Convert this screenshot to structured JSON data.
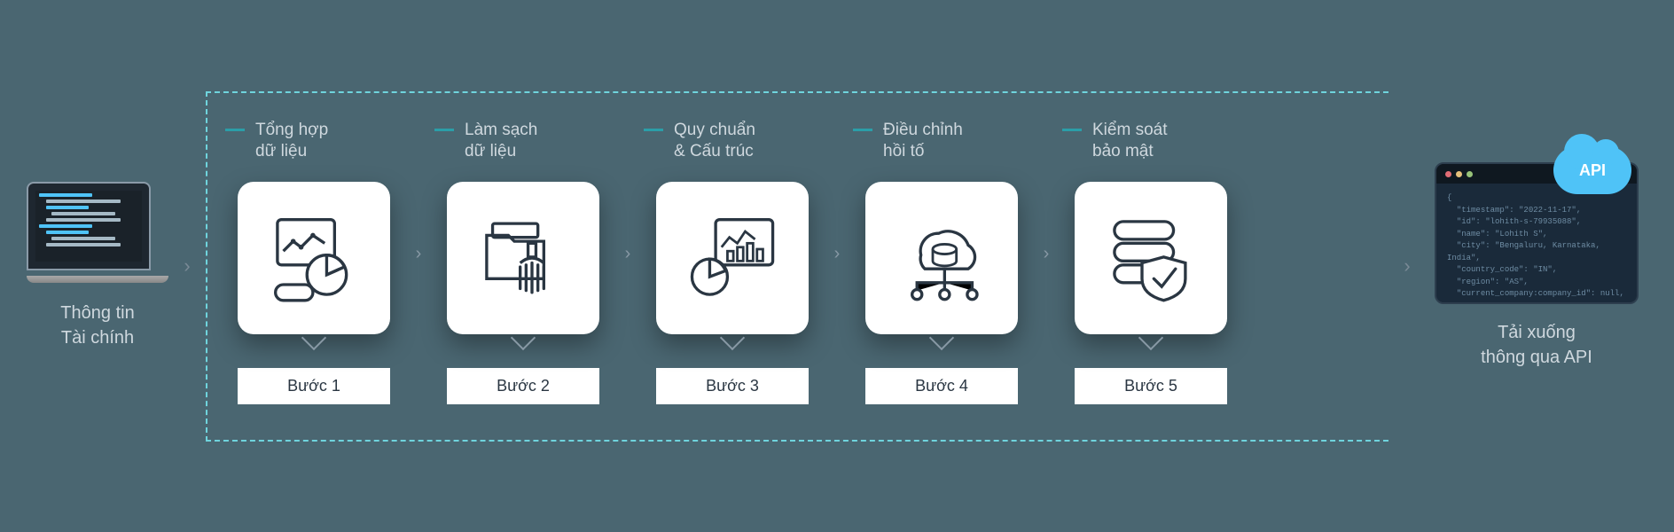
{
  "input": {
    "label_line1": "Thông tin",
    "label_line2": "Tài chính"
  },
  "steps": [
    {
      "title_line1": "Tổng hợp",
      "title_line2": "dữ liệu",
      "badge": "Bước 1",
      "icon": "chart-pie-icon"
    },
    {
      "title_line1": "Làm sạch",
      "title_line2": "dữ liệu",
      "badge": "Bước 2",
      "icon": "clean-folder-icon"
    },
    {
      "title_line1": "Quy chuẩn",
      "title_line2": "& Cấu trúc",
      "badge": "Bước 3",
      "icon": "bar-graph-icon"
    },
    {
      "title_line1": "Điều chỉnh",
      "title_line2": "hồi tố",
      "badge": "Bước 4",
      "icon": "cloud-network-icon"
    },
    {
      "title_line1": "Kiểm soát",
      "title_line2": "bảo mật",
      "badge": "Bước 5",
      "icon": "shield-stack-icon"
    }
  ],
  "output": {
    "cloud_label": "API",
    "label_line1": "Tải xuống",
    "label_line2": "thông qua API",
    "json_sample": {
      "l1": "\"timestamp\": \"2022-11-17\",",
      "l2": "\"id\": \"lohith-s-79935088\",",
      "l3": "\"name\": \"Lohith S\",",
      "l4": "\"city\": \"Bengaluru, Karnataka, India\",",
      "l5": "\"country_code\": \"IN\",",
      "l6": "\"region\": \"AS\",",
      "l7": "\"current_company:company_id\": null,"
    }
  }
}
